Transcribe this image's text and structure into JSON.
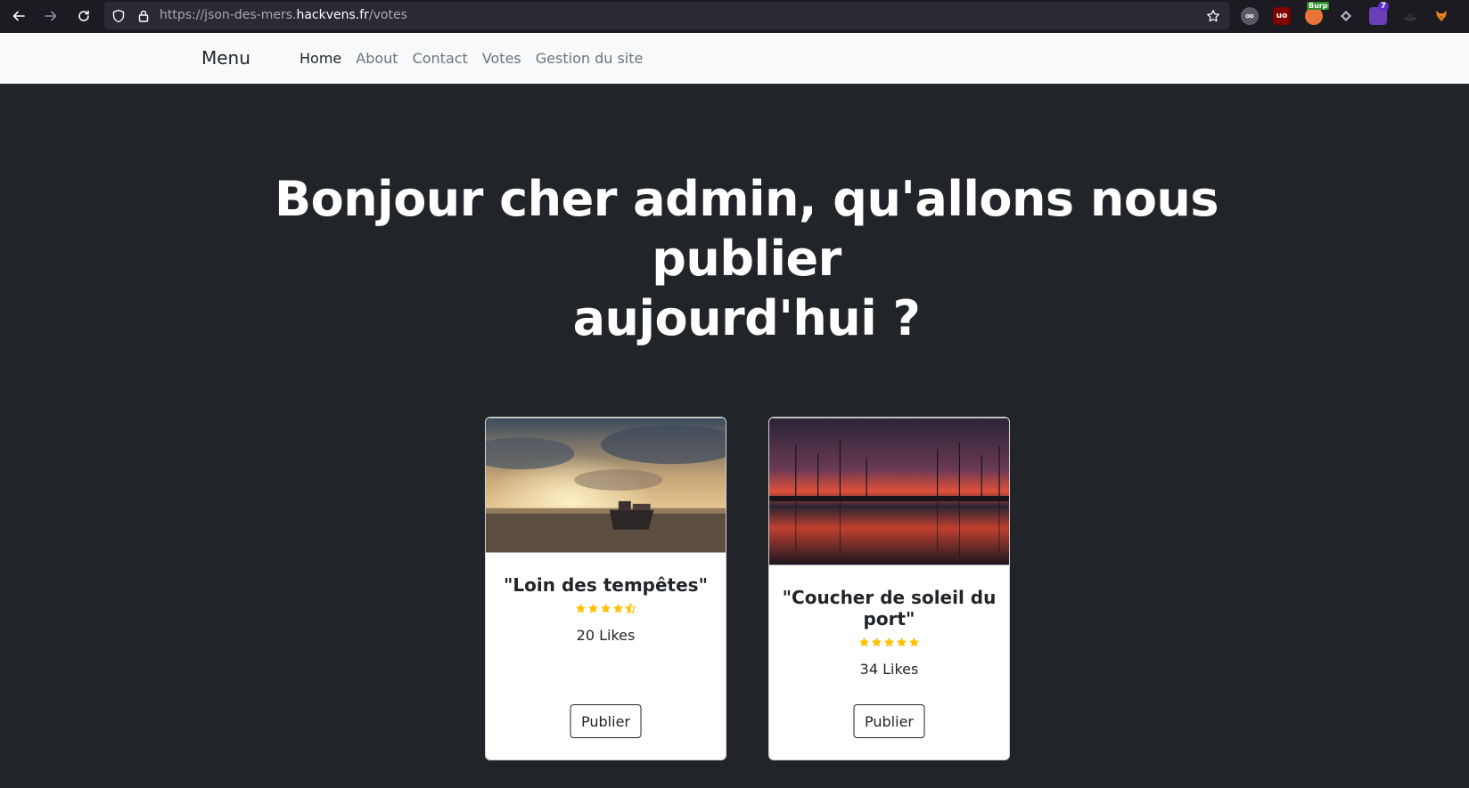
{
  "browser": {
    "url_prefix": "https://json-des-mers.",
    "url_host": "hackvens.fr",
    "url_path": "/votes",
    "extension_badges": {
      "burp": "Burp",
      "count": "7"
    }
  },
  "navbar": {
    "brand": "Menu",
    "links": [
      {
        "label": "Home",
        "active": true
      },
      {
        "label": "About",
        "active": false
      },
      {
        "label": "Contact",
        "active": false
      },
      {
        "label": "Votes",
        "active": false
      },
      {
        "label": "Gestion du site",
        "active": false
      }
    ]
  },
  "hero": {
    "line1": "Bonjour cher admin, qu'allons nous publier",
    "line2": "aujourd'hui ?"
  },
  "cards": [
    {
      "title": "\"Loin des tempêtes\"",
      "rating": 4.5,
      "likes": "20 Likes",
      "button": "Publier"
    },
    {
      "title": "\"Coucher de soleil du port\"",
      "rating": 5,
      "likes": "34 Likes",
      "button": "Publier"
    }
  ],
  "colors": {
    "page_bg": "#212529",
    "navbar_bg": "#f8f9fa",
    "star": "#ffc107",
    "browser_bg": "#1c1b22"
  }
}
